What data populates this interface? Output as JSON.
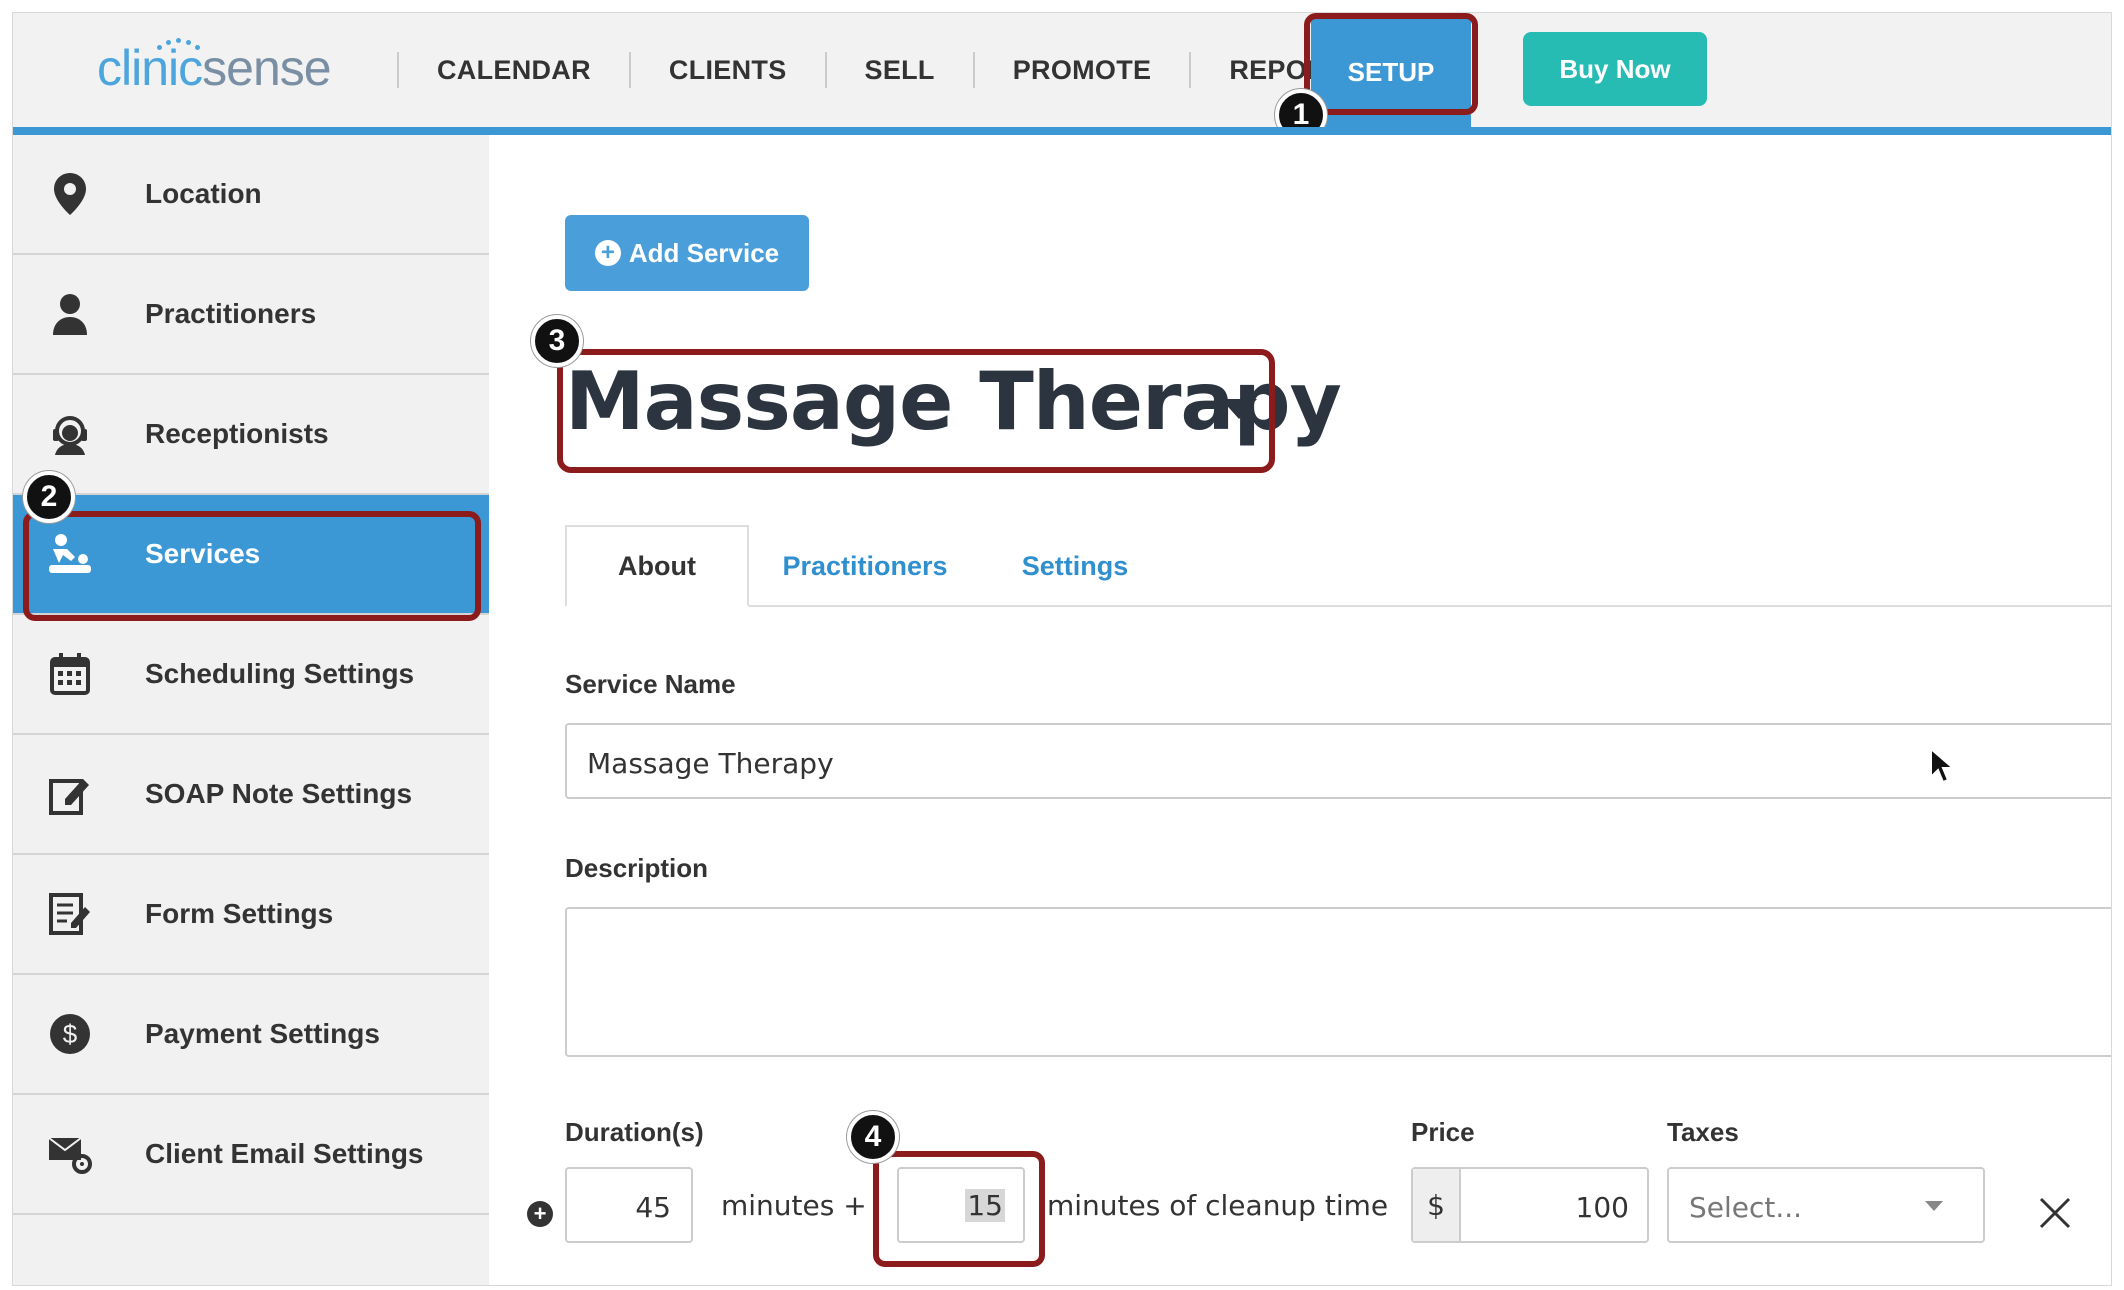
{
  "brand": {
    "logo_part1": "clinic",
    "logo_part2": "sense"
  },
  "nav": {
    "items": [
      "CALENDAR",
      "CLIENTS",
      "SELL",
      "PROMOTE",
      "REPORTS"
    ],
    "setup_label": "SETUP",
    "buy_now_label": "Buy Now"
  },
  "annotations": {
    "step1": "1",
    "step2": "2",
    "step3": "3",
    "step4": "4"
  },
  "sidebar": {
    "items": [
      {
        "label": "Location",
        "icon": "map-pin-icon"
      },
      {
        "label": "Practitioners",
        "icon": "person-icon"
      },
      {
        "label": "Receptionists",
        "icon": "receptionist-headset-icon"
      },
      {
        "label": "Services",
        "icon": "massage-icon",
        "active": true
      },
      {
        "label": "Scheduling Settings",
        "icon": "calendar-icon"
      },
      {
        "label": "SOAP Note Settings",
        "icon": "edit-note-icon"
      },
      {
        "label": "Form Settings",
        "icon": "form-icon"
      },
      {
        "label": "Payment Settings",
        "icon": "dollar-circle-icon"
      },
      {
        "label": "Client Email Settings",
        "icon": "email-settings-icon"
      }
    ]
  },
  "main": {
    "add_service_label": "Add Service",
    "service_title": "Massage Therapy",
    "tabs": [
      {
        "label": "About",
        "active": true
      },
      {
        "label": "Practitioners"
      },
      {
        "label": "Settings"
      }
    ],
    "service_name_label": "Service Name",
    "service_name_value": "Massage Therapy",
    "description_label": "Description",
    "description_value": "",
    "durations_label": "Duration(s)",
    "duration_value": "45",
    "minutes_plus": "minutes +",
    "cleanup_value": "15",
    "cleanup_text": "minutes of cleanup time",
    "price_label": "Price",
    "currency": "$",
    "price_value": "100",
    "taxes_label": "Taxes",
    "taxes_placeholder": "Select..."
  },
  "colors": {
    "accent_blue": "#3c98d5",
    "teal": "#27bcb3",
    "highlight_red": "#8c1b1b"
  }
}
